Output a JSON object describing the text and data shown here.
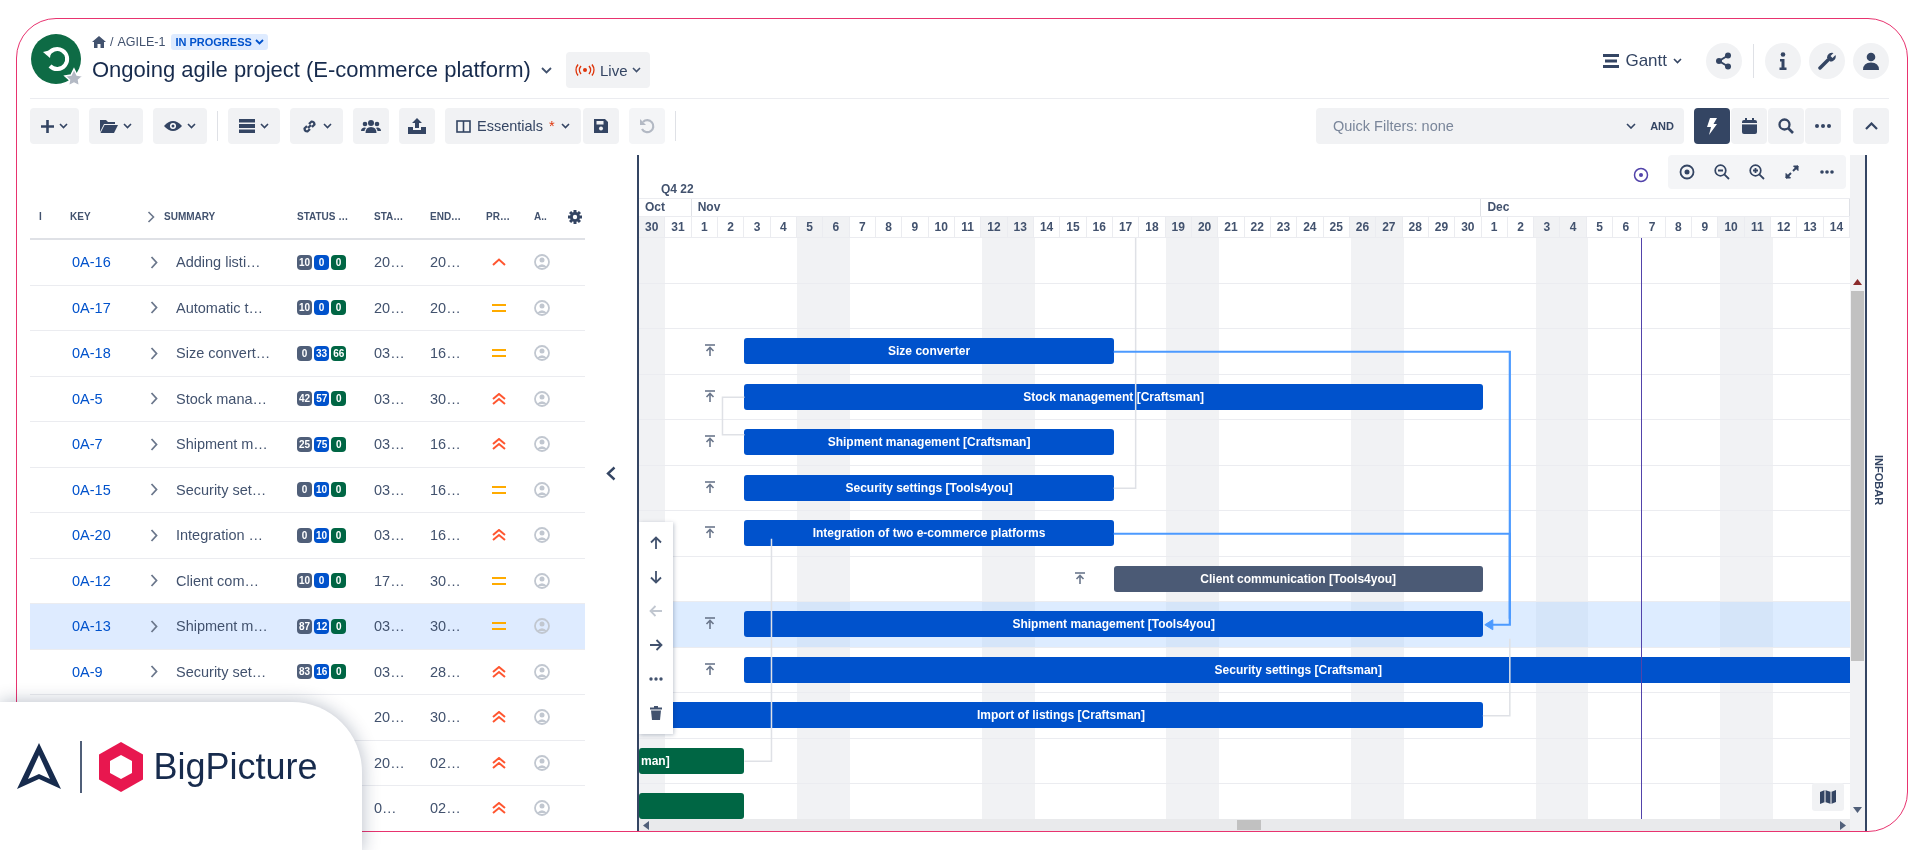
{
  "breadcrumb": {
    "separator": "/",
    "project_key": "AGILE-1",
    "status": "IN PROGRESS"
  },
  "title": "Ongoing agile project (E-commerce platform)",
  "live_button": "Live",
  "view_switch": "Gantt",
  "toolbar": {
    "view_preset": "Essentials",
    "preset_modified_mark": "*",
    "undo_disabled": true
  },
  "quick_filters": {
    "placeholder": "Quick Filters: none",
    "operator": "AND",
    "auto_scheduling_on": true
  },
  "table": {
    "columns": [
      "I",
      "KEY",
      "SUMMARY",
      "STATUS …",
      "STA…",
      "END…",
      "PR…",
      "A.."
    ],
    "rows": [
      {
        "key": "0A-16",
        "summary": "Adding listi…",
        "status": [
          "10",
          "0",
          "0"
        ],
        "start": "20…",
        "end": "20…",
        "priority": {
          "kind": "high"
        },
        "selected": false
      },
      {
        "key": "0A-17",
        "summary": "Automatic t…",
        "status": [
          "10",
          "0",
          "0"
        ],
        "start": "20…",
        "end": "20…",
        "priority": {
          "kind": "medium"
        },
        "selected": false
      },
      {
        "key": "0A-18",
        "summary": "Size convert…",
        "status": [
          "0",
          "33",
          "66"
        ],
        "start": "03…",
        "end": "16…",
        "priority": {
          "kind": "medium"
        },
        "selected": false,
        "bar": {
          "label": "Size converter",
          "color": "#0052cc"
        }
      },
      {
        "key": "0A-5",
        "summary": "Stock mana…",
        "status": [
          "42",
          "57",
          "0"
        ],
        "start": "03…",
        "end": "30…",
        "priority": {
          "kind": "highest"
        },
        "selected": false,
        "bar": {
          "label": "Stock management [Craftsman]",
          "color": "#0052cc"
        }
      },
      {
        "key": "0A-7",
        "summary": "Shipment m…",
        "status": [
          "25",
          "75",
          "0"
        ],
        "start": "03…",
        "end": "16…",
        "priority": {
          "kind": "highest"
        },
        "selected": false,
        "bar": {
          "label": "Shipment management [Craftsman]",
          "color": "#0052cc"
        }
      },
      {
        "key": "0A-15",
        "summary": "Security set…",
        "status": [
          "0",
          "10",
          "0"
        ],
        "start": "03…",
        "end": "16…",
        "priority": {
          "kind": "medium"
        },
        "selected": false,
        "bar": {
          "label": "Security settings [Tools4you]",
          "color": "#0052cc"
        }
      },
      {
        "key": "0A-20",
        "summary": "Integration …",
        "status": [
          "0",
          "10",
          "0"
        ],
        "start": "03…",
        "end": "16…",
        "priority": {
          "kind": "highest"
        },
        "selected": false,
        "bar": {
          "label": "Integration of two e-commerce platforms",
          "color": "#0052cc"
        }
      },
      {
        "key": "0A-12",
        "summary": "Client com…",
        "status": [
          "10",
          "0",
          "0"
        ],
        "start": "17…",
        "end": "30…",
        "priority": {
          "kind": "medium"
        },
        "selected": false,
        "bar": {
          "label": "Client communication [Tools4you]",
          "color": "#4b5a75"
        }
      },
      {
        "key": "0A-13",
        "summary": "Shipment m…",
        "status": [
          "87",
          "12",
          "0"
        ],
        "start": "03…",
        "end": "30…",
        "priority": {
          "kind": "medium"
        },
        "selected": true,
        "bar": {
          "label": "Shipment management [Tools4you]",
          "color": "#0052cc"
        }
      },
      {
        "key": "0A-9",
        "summary": "Security set…",
        "status": [
          "83",
          "16",
          "0"
        ],
        "start": "03…",
        "end": "28…",
        "priority": {
          "kind": "highest"
        },
        "selected": false,
        "bar": {
          "label": "Security settings [Craftsman]",
          "color": "#0052cc"
        }
      },
      {
        "start": "20…",
        "end": "30…",
        "priority": {
          "kind": "highest"
        },
        "selected": false,
        "bar": {
          "label": "Import of listings [Craftsman]",
          "color": "#0052cc"
        }
      },
      {
        "start": "20…",
        "end": "02…",
        "priority": {
          "kind": "highest"
        },
        "selected": false,
        "bar": {
          "label": "man]",
          "color": "#006644"
        }
      },
      {
        "start": "0…",
        "end": "02…",
        "priority": {
          "kind": "highest"
        },
        "selected": false,
        "bar": {
          "color": "#006644"
        }
      }
    ]
  },
  "timeline": {
    "quarter": "Q4 22",
    "months": [
      {
        "label": "Oct",
        "days": [
          "30",
          "31"
        ]
      },
      {
        "label": "Nov",
        "days": [
          "1",
          "2",
          "3",
          "4",
          "5",
          "6",
          "7",
          "8",
          "9",
          "10",
          "11",
          "12",
          "13",
          "14",
          "15",
          "16",
          "17",
          "18",
          "19",
          "20",
          "21",
          "22",
          "23",
          "24",
          "25",
          "26",
          "27",
          "28",
          "29",
          "30"
        ]
      },
      {
        "label": "Dec",
        "days": [
          "1",
          "2",
          "3",
          "4",
          "5",
          "6",
          "7",
          "8",
          "9",
          "10",
          "11",
          "12",
          "13",
          "14"
        ]
      }
    ]
  },
  "infobar": "INFOBAR",
  "brand_card": {
    "name": "BigPicture"
  }
}
